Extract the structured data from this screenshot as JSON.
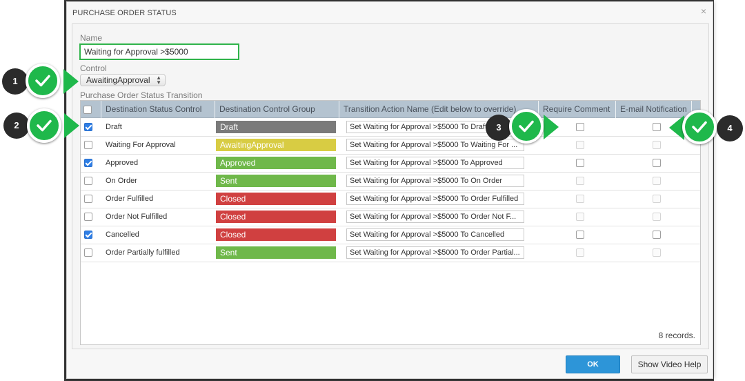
{
  "dialog": {
    "title": "PURCHASE ORDER STATUS",
    "close_glyph": "×"
  },
  "form": {
    "name_label": "Name",
    "name_value": "Waiting for Approval >$5000",
    "control_label": "Control",
    "control_value": "AwaitingApproval",
    "transition_label": "Purchase Order Status Transition"
  },
  "grid": {
    "columns": [
      "Destination Status Control",
      "Destination Control Group",
      "Transition Action Name (Edit below to override)",
      "Require Comment",
      "E-mail Notification"
    ],
    "rows": [
      {
        "status": "Draft",
        "checked": true,
        "group": "Draft",
        "group_color": "#7a7a7a",
        "action": "Set Waiting for Approval >$5000 To Draft",
        "comment_enabled": true,
        "email_enabled": true
      },
      {
        "status": "Waiting For Approval",
        "checked": false,
        "group": "AwaitingApproval",
        "group_color": "#d8cc43",
        "action": "Set Waiting for Approval >$5000 To Waiting For ...",
        "comment_enabled": false,
        "email_enabled": false
      },
      {
        "status": "Approved",
        "checked": true,
        "group": "Approved",
        "group_color": "#6fb84a",
        "action": "Set Waiting for Approval >$5000 To Approved",
        "comment_enabled": true,
        "email_enabled": true
      },
      {
        "status": "On Order",
        "checked": false,
        "group": "Sent",
        "group_color": "#6fb84a",
        "action": "Set Waiting for Approval >$5000 To On Order",
        "comment_enabled": false,
        "email_enabled": false
      },
      {
        "status": "Order Fulfilled",
        "checked": false,
        "group": "Closed",
        "group_color": "#d04040",
        "action": "Set Waiting for Approval >$5000 To Order Fulfilled",
        "comment_enabled": false,
        "email_enabled": false
      },
      {
        "status": "Order Not Fulfilled",
        "checked": false,
        "group": "Closed",
        "group_color": "#d04040",
        "action": "Set Waiting for Approval >$5000 To Order Not F...",
        "comment_enabled": false,
        "email_enabled": false
      },
      {
        "status": "Cancelled",
        "checked": true,
        "group": "Closed",
        "group_color": "#d04040",
        "action": "Set Waiting for Approval >$5000 To Cancelled",
        "comment_enabled": true,
        "email_enabled": true
      },
      {
        "status": "Order Partially fulfilled",
        "checked": false,
        "group": "Sent",
        "group_color": "#6fb84a",
        "action": "Set Waiting for Approval >$5000 To Order Partial...",
        "comment_enabled": false,
        "email_enabled": false
      }
    ],
    "records_text": "8 records."
  },
  "footer": {
    "ok_label": "OK",
    "help_label": "Show Video Help"
  },
  "callouts": [
    "1",
    "2",
    "3",
    "4"
  ],
  "colors": {
    "accent_green": "#1fb84b",
    "ok_blue": "#2d95d8",
    "header_bg": "#b4c3d0"
  }
}
